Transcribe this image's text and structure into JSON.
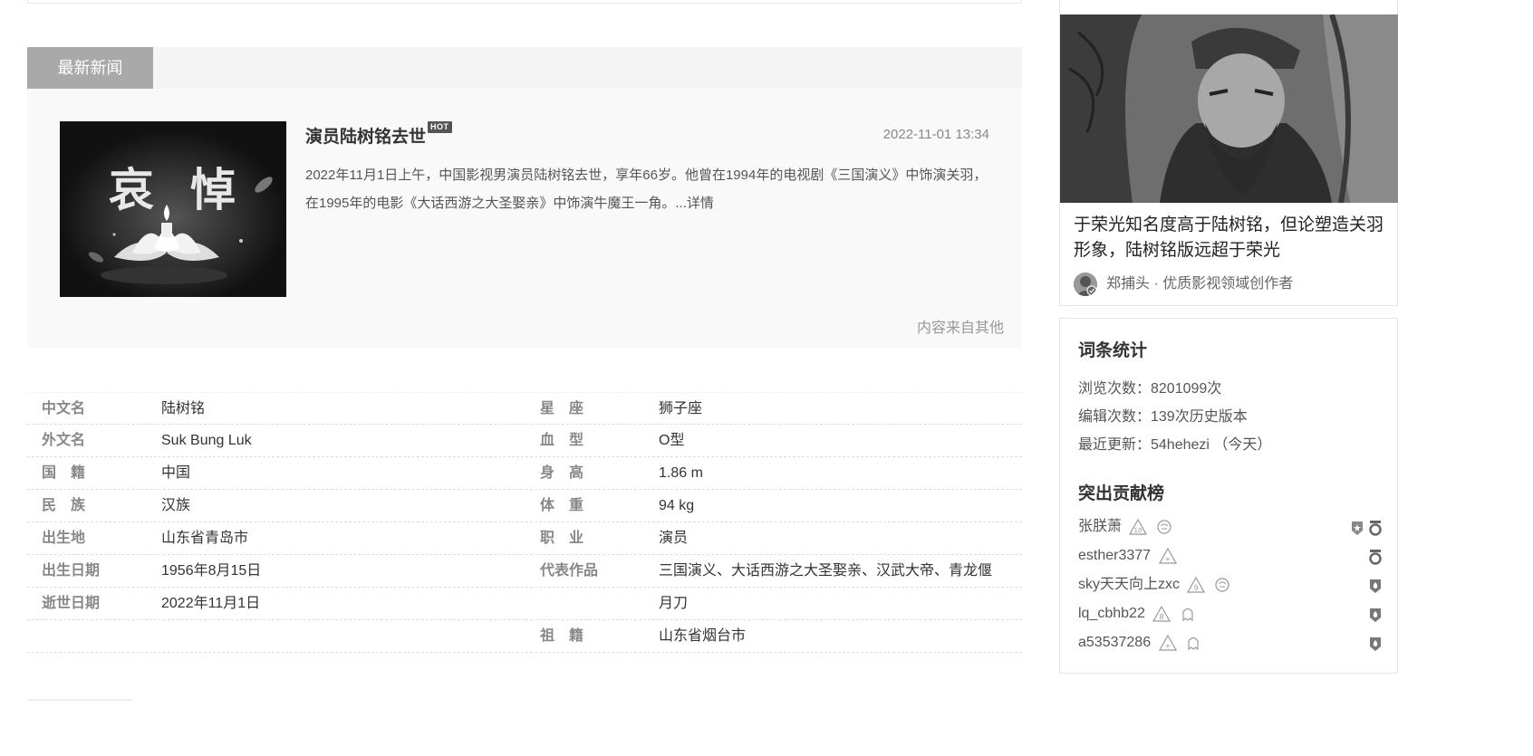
{
  "news": {
    "tab_label": "最新新闻",
    "thumb_text_left": "哀",
    "thumb_text_right": "悼",
    "title": "演员陆树铭去世",
    "hot_label": "HOT",
    "time": "2022-11-01 13:34",
    "summary": "2022年11月1日上午，中国影视男演员陆树铭去世，享年66岁。他曾在1994年的电视剧《三国演义》中饰演关羽，在1995年的电影《大话西游之大圣娶亲》中饰演牛魔王一角。...详情",
    "source": "内容来自其他"
  },
  "info": {
    "left": [
      {
        "key": "中文名",
        "value": "陆树铭"
      },
      {
        "key": "外文名",
        "value": "Suk Bung Luk"
      },
      {
        "key": "国　籍",
        "value": "中国"
      },
      {
        "key": "民　族",
        "value": "汉族"
      },
      {
        "key": "出生地",
        "value": "山东省青岛市"
      },
      {
        "key": "出生日期",
        "value": "1956年8月15日"
      },
      {
        "key": "逝世日期",
        "value": "2022年11月1日"
      },
      {
        "key": "",
        "value": ""
      }
    ],
    "right": [
      {
        "key": "星　座",
        "value": "狮子座"
      },
      {
        "key": "血　型",
        "value": "O型"
      },
      {
        "key": "身　高",
        "value": "1.86 m"
      },
      {
        "key": "体　重",
        "value": "94 kg"
      },
      {
        "key": "职　业",
        "value": "演员"
      },
      {
        "key": "代表作品",
        "value": "三国演义、大话西游之大圣娶亲、汉武大帝、青龙偃"
      },
      {
        "key": "",
        "value": "月刀"
      },
      {
        "key": "祖　籍",
        "value": "山东省烟台市"
      }
    ]
  },
  "card": {
    "title": "于荣光知名度高于陆树铭，但论塑造关羽形象，陆树铭版远超于荣光",
    "author": "郑捕头 · 优质影视领域创作者"
  },
  "stats": {
    "heading": "词条统计",
    "views": "浏览次数：8201099次",
    "edits": "编辑次数：139次历史版本",
    "updated": "最近更新：54hehezi （今天）",
    "contrib_heading": "突出贡献榜",
    "contributors": [
      {
        "name": "张朕萧",
        "level": "10"
      },
      {
        "name": "esther3377",
        "level": "+"
      },
      {
        "name": "sky天天向上zxc",
        "level": "9"
      },
      {
        "name": "lq_cbhb22",
        "level": "8"
      },
      {
        "name": "a53537286",
        "level": "+"
      }
    ]
  },
  "colors": {
    "tab_bg": "#a9a9a9",
    "header_bg": "#f4f4f4",
    "body_bg": "#f9f9f9"
  }
}
